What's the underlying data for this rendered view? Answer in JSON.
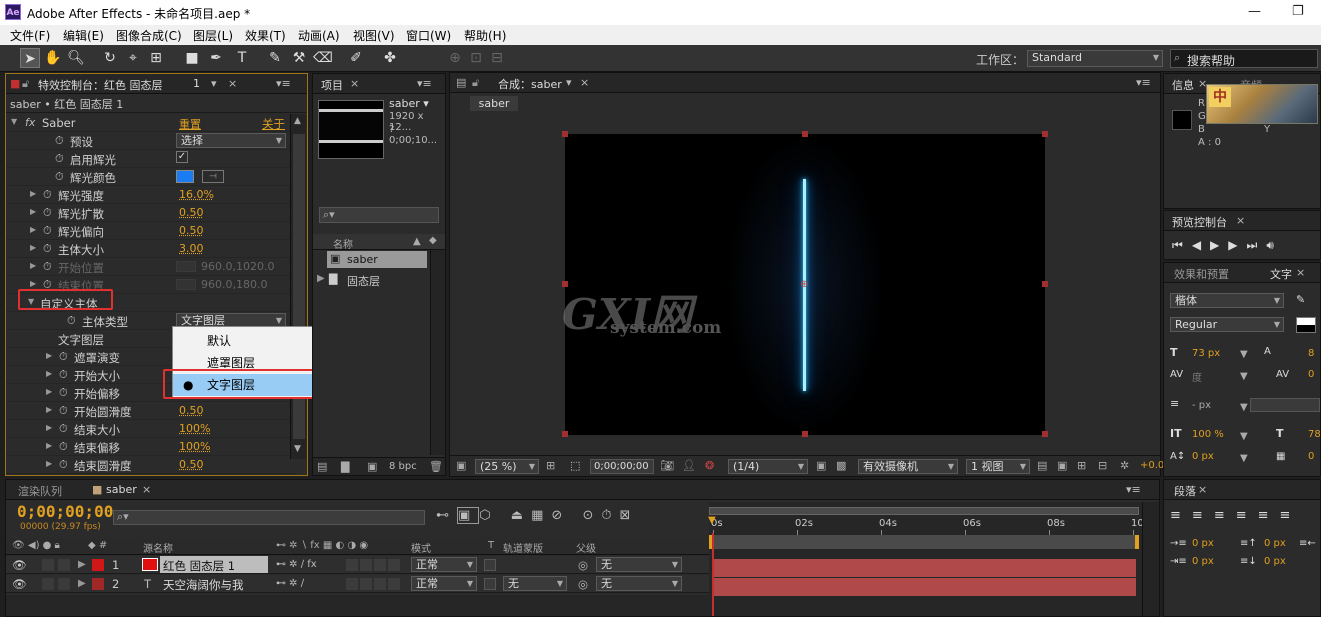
{
  "window": {
    "title": "Adobe After Effects - 未命名项目.aep *",
    "app_icon": "Ae",
    "min": "—",
    "restore": "❐"
  },
  "menu": [
    "文件(F)",
    "编辑(E)",
    "图像合成(C)",
    "图层(L)",
    "效果(T)",
    "动画(A)",
    "视图(V)",
    "窗口(W)",
    "帮助(H)"
  ],
  "toolbar": {
    "workspace_label": "工作区：",
    "workspace_value": "Standard",
    "search_placeholder": "搜索帮助"
  },
  "effects_panel": {
    "tab": "特效控制台：红色 固态层",
    "tab_suffix": "1",
    "layer_path": "saber • 红色 固态层 1",
    "effect_name": "Saber",
    "reset": "重置",
    "about": "关于",
    "rows": [
      {
        "label": "预设",
        "value": "选择",
        "type": "dropdown"
      },
      {
        "label": "启用辉光",
        "value": "✓",
        "type": "check"
      },
      {
        "label": "辉光颜色",
        "type": "color"
      },
      {
        "label": "辉光强度",
        "value": "16.0%"
      },
      {
        "label": "辉光扩散",
        "value": "0.50"
      },
      {
        "label": "辉光偏向",
        "value": "0.50"
      },
      {
        "label": "主体大小",
        "value": "3.00"
      },
      {
        "label": "开始位置",
        "value": "960.0,1020.0",
        "disabled": true
      },
      {
        "label": "结束位置",
        "value": "960.0,180.0",
        "disabled": true
      },
      {
        "label": "自定义主体",
        "type": "group"
      },
      {
        "label": "主体类型",
        "value": "文字图层",
        "type": "dropdown"
      },
      {
        "label": "文字图层",
        "type": "plain"
      },
      {
        "label": "遮罩演变",
        "value": ""
      },
      {
        "label": "开始大小",
        "value": ""
      },
      {
        "label": "开始偏移",
        "value": ""
      },
      {
        "label": "开始圆滑度",
        "value": "0.50"
      },
      {
        "label": "结束大小",
        "value": "100%"
      },
      {
        "label": "结束偏移",
        "value": "100%"
      },
      {
        "label": "结束圆滑度",
        "value": "0.50"
      }
    ],
    "popup": {
      "items": [
        "默认",
        "遮罩图层",
        "文字图层"
      ],
      "selected": 2
    }
  },
  "project_panel": {
    "tab": "项目",
    "item_name": "saber ▾",
    "item_info1": "1920 x 12...",
    "item_info2": "? 0;00;10...",
    "col_name": "名称",
    "items": [
      "saber",
      "固态层"
    ],
    "bpc": "8 bpc"
  },
  "comp_panel": {
    "tab": "合成：saber",
    "breadcrumb": "saber",
    "zoom": "(25 %)",
    "timecode": "0;00;00;00",
    "resolution": "(1/4)",
    "camera": "有效摄像机",
    "views": "1 视图",
    "offset": "+0.0"
  },
  "watermark": {
    "main": "GXI网",
    "sub": "system.com"
  },
  "info_panel": {
    "tab": "信息",
    "tab2": "音频",
    "r": "R",
    "g": "G",
    "b": "B",
    "a": "A : 0",
    "x": "X",
    "y": "Y"
  },
  "preview_panel": {
    "tab": "预览控制台"
  },
  "char_panel": {
    "tab1": "效果和预置",
    "tab2": "文字",
    "font": "楷体",
    "style": "Regular",
    "size": "73 px",
    "leading": "8",
    "kerning": "度",
    "tracking": "0",
    "stroke": "- px",
    "vscale": "100 %",
    "hscale": "78",
    "baseline": "0 px",
    "tsume": "0"
  },
  "para_panel": {
    "tab": "段落",
    "indent_left": "0 px",
    "indent_right": "0 px",
    "space_before": "0 px",
    "space_after": "0 px",
    "first_line": "0 px"
  },
  "timeline": {
    "tab_render": "渲染队列",
    "tab_comp": "saber",
    "timecode": "0;00;00;00",
    "fps": "00000 (29.97 fps)",
    "col_source": "源名称",
    "col_mode": "模式",
    "col_t": "T",
    "col_trkmat": "轨道蒙版",
    "col_parent": "父级",
    "layers": [
      {
        "num": "1",
        "name": "红色 固态层  1",
        "mode": "正常",
        "trk": "",
        "parent": "无",
        "color": "#d01818"
      },
      {
        "num": "2",
        "name": "天空海阔你与我",
        "mode": "正常",
        "trk": "无",
        "parent": "无",
        "color": "#a02828"
      }
    ],
    "ruler": [
      "0s",
      "02s",
      "04s",
      "06s",
      "08s",
      "10s"
    ]
  }
}
